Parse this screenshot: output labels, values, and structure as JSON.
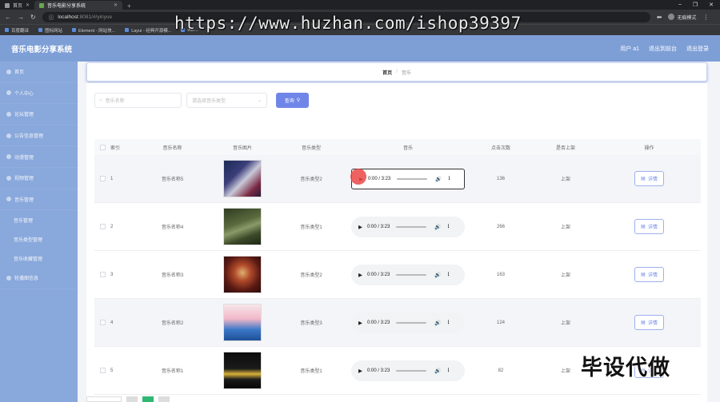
{
  "browser": {
    "tabs": [
      {
        "label": "首页",
        "active": false
      },
      {
        "label": "音乐电影分享系统",
        "active": true
      }
    ],
    "url_host": "localhost",
    "url_rest": ":8081/#/yinyue",
    "profile_label": "无痕模式",
    "bookmarks": [
      "百度翻译",
      "图标网站",
      "Element - 网站快...",
      "Layui - 经典开源模...",
      "vue..."
    ]
  },
  "watermark": {
    "top": "https://www.huzhan.com/ishop39397",
    "bottom": "毕设代做"
  },
  "header": {
    "title": "音乐电影分享系统",
    "user": "用户 a1",
    "back_to_console": "退出到前台",
    "logout": "退出登录"
  },
  "sidebar": {
    "items": [
      {
        "label": "首页"
      },
      {
        "label": "个人中心"
      },
      {
        "label": "论坛管理"
      },
      {
        "label": "公告信息管理"
      },
      {
        "label": "动漫管理"
      },
      {
        "label": "视频管理"
      },
      {
        "label": "音乐管理"
      }
    ],
    "sub_items": [
      {
        "label": "音乐管理"
      },
      {
        "label": "音乐类型管理"
      },
      {
        "label": "音乐收藏管理"
      }
    ],
    "last_item": {
      "label": "轮播图信息"
    }
  },
  "breadcrumb": {
    "home": "首页",
    "separator": "/",
    "current": "音乐"
  },
  "search": {
    "name_placeholder": "音乐名称",
    "type_placeholder": "请选择音乐类型",
    "button_label": "查询"
  },
  "table": {
    "headers": [
      "索引",
      "音乐名称",
      "音乐图片",
      "音乐类型",
      "音乐",
      "点击次数",
      "是否上架",
      "操作"
    ],
    "rows": [
      {
        "index": "1",
        "name": "音乐名称5",
        "type": "音乐类型2",
        "time": "0:00 / 3:23",
        "plays": "136",
        "status": "上架",
        "action": "详情"
      },
      {
        "index": "2",
        "name": "音乐名称4",
        "type": "音乐类型1",
        "time": "0:00 / 3:23",
        "plays": "266",
        "status": "上架",
        "action": "详情"
      },
      {
        "index": "3",
        "name": "音乐名称3",
        "type": "音乐类型2",
        "time": "0:00 / 3:23",
        "plays": "163",
        "status": "上架",
        "action": "详情"
      },
      {
        "index": "4",
        "name": "音乐名称2",
        "type": "音乐类型3",
        "time": "0:00 / 3:23",
        "plays": "124",
        "status": "上架",
        "action": "详情"
      },
      {
        "index": "5",
        "name": "音乐名称1",
        "type": "音乐类型1",
        "time": "0:00 / 3:23",
        "plays": "82",
        "status": "上架",
        "action": "详情"
      }
    ]
  },
  "colors": {
    "header_bg": "#7e9fd6",
    "sidebar_bg": "#89a8dc",
    "primary": "#6f86e8",
    "pager_active": "#2eb872"
  }
}
